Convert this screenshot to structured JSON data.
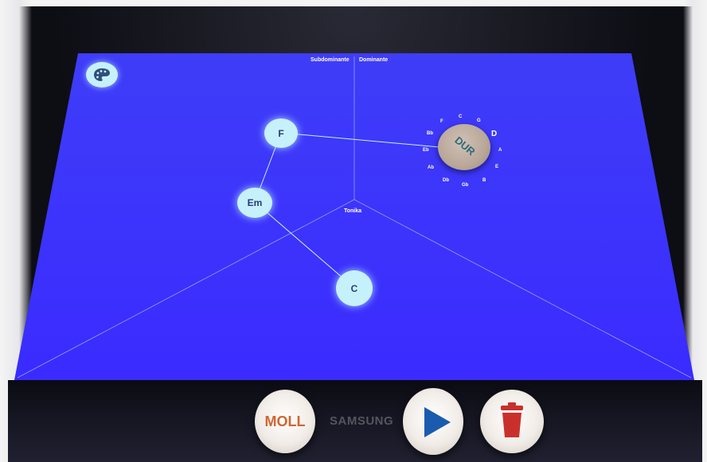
{
  "zones": {
    "subdominante": "Subdominante",
    "dominante": "Dominante",
    "tonika": "Tonika"
  },
  "chords": {
    "f": "F",
    "em": "Em",
    "c": "C"
  },
  "key_wheel": {
    "notes": [
      "C",
      "G",
      "D",
      "A",
      "E",
      "B",
      "Gb",
      "Db",
      "Ab",
      "Eb",
      "Bb",
      "F"
    ],
    "selected": "D",
    "knob_label": "DUR"
  },
  "controls": {
    "minor_button": "MOLL",
    "palette_icon": "palette-icon",
    "play_icon": "play-icon",
    "delete_icon": "trash-icon"
  },
  "device": {
    "brand": "SAMSUNG"
  },
  "colors": {
    "screen_blue": "#3a2bff",
    "node_fill": "#c6f1fb",
    "play_blue": "#1a5bb0",
    "trash_red": "#c9302c",
    "moll_orange": "#d2662f"
  }
}
